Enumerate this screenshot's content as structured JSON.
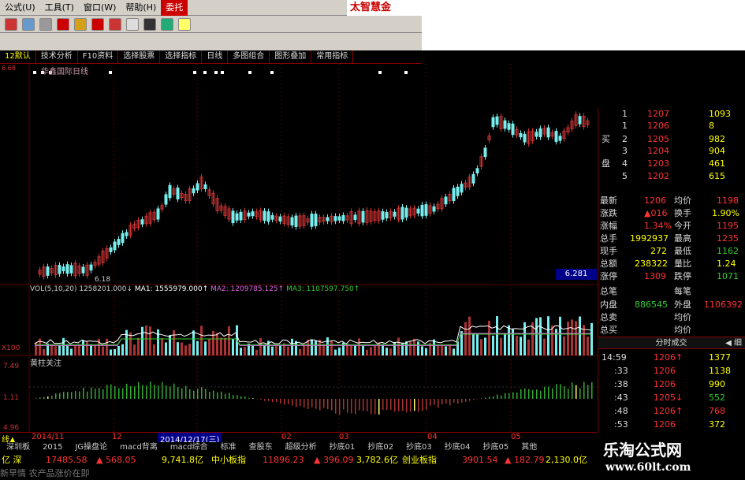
{
  "menubar": {
    "items": [
      "公式(U)",
      "工具(T)",
      "窗口(W)",
      "帮助(H)",
      "委托"
    ],
    "brand": "太智慧金"
  },
  "tabs": [
    "12默认",
    "技术分析",
    "F10资料",
    "选择股票",
    "选择指标",
    "日线",
    "多图组合",
    "图形叠加",
    "常用指标"
  ],
  "chart": {
    "stock_title": "华鑫国际日线",
    "low_label": "6.18",
    "price_box": "6.281",
    "vol_legend": {
      "vol": "VOL(5,10,20)",
      "vol_val": "1258201.000↓",
      "ma1": "MA1: 1555979.000↑",
      "ma2": "MA2: 1209785.125↑",
      "ma3": "MA3: 1107597.750↑"
    },
    "vol_axis": "X100",
    "sub_title": "黄柱关注",
    "sub_axis": [
      "7.49",
      "1.11",
      "4.96"
    ]
  },
  "quote": {
    "order_rows": [
      {
        "label": "",
        "num": "1",
        "price": "1207",
        "vol": "1093"
      },
      {
        "label": "",
        "num": "1",
        "price": "1206",
        "vol": "8"
      },
      {
        "label": "买",
        "num": "2",
        "price": "1205",
        "vol": "982"
      },
      {
        "label": "",
        "num": "3",
        "price": "1204",
        "vol": "904"
      },
      {
        "label": "盘",
        "num": "4",
        "price": "1203",
        "vol": "461"
      },
      {
        "label": "",
        "num": "5",
        "price": "1202",
        "vol": "615"
      }
    ],
    "stats": [
      {
        "k1": "最新",
        "v1": "1206",
        "k2": "均价",
        "v2": "1198"
      },
      {
        "k1": "涨跌",
        "v1": "▲016",
        "k2": "换手",
        "v2": "1.90%"
      },
      {
        "k1": "涨幅",
        "v1": "1.34%",
        "k2": "今开",
        "v2": "1195"
      },
      {
        "k1": "总手",
        "v1": "1992937",
        "k2": "最高",
        "v2": "1235"
      },
      {
        "k1": "现手",
        "v1": "272",
        "k2": "最低",
        "v2": "1162"
      },
      {
        "k1": "总额",
        "v1": "238322",
        "k2": "量比",
        "v2": "1.24"
      },
      {
        "k1": "涨停",
        "v1": "1309",
        "k2": "跌停",
        "v2": "1071"
      },
      {
        "k1": "总笔",
        "v1": "",
        "k2": "每笔",
        "v2": ""
      },
      {
        "k1": "内盘",
        "v1": "886545",
        "k2": "外盘",
        "v2": "1106392"
      },
      {
        "k1": "总卖",
        "v1": "",
        "k2": "均价",
        "v2": ""
      },
      {
        "k1": "总买",
        "v1": "",
        "k2": "均价",
        "v2": ""
      }
    ],
    "rt_header": "分时成交",
    "rt_btn": "细",
    "trades": [
      {
        "t": "14:59",
        "p": "1206↑",
        "v": "1377"
      },
      {
        "t": ":33",
        "p": "1206",
        "v": "1138"
      },
      {
        "t": ":38",
        "p": "1206",
        "v": "990"
      },
      {
        "t": ":43",
        "p": "1205↓",
        "v": "552"
      },
      {
        "t": ":48",
        "p": "1206↑",
        "v": "768"
      },
      {
        "t": ":53",
        "p": "1206",
        "v": "372"
      }
    ]
  },
  "datebar": {
    "left": "线▲",
    "d1": "2014/11",
    "d2": "12",
    "cursor_date": "2014/12/17(三)",
    "d3": "02",
    "d4": "03",
    "d5": "04",
    "d6": "05"
  },
  "sectors": [
    "深圳板",
    "2015",
    "JG操盘论",
    "macd背离",
    "macd综合",
    "标准",
    "查股东",
    "超级分析",
    "抄底01",
    "抄底02",
    "抄底03",
    "抄底04",
    "抄底05",
    "其他"
  ],
  "indexbar": {
    "a": "亿 深",
    "b": "17485.58",
    "c": "▲ 568.05",
    "d": "9,741.8亿",
    "e": "中小板指",
    "f": "11896.23",
    "g": "▲ 396.09",
    "h": "3,782.6亿",
    "i": "创业板指",
    "j": "3901.54",
    "k": "▲ 182.79",
    "l": "2,130.0亿"
  },
  "ticker": "新早情 农产品涨价在即",
  "watermark": {
    "line1": "乐淘公式网",
    "line2": "www.60lt.com"
  }
}
